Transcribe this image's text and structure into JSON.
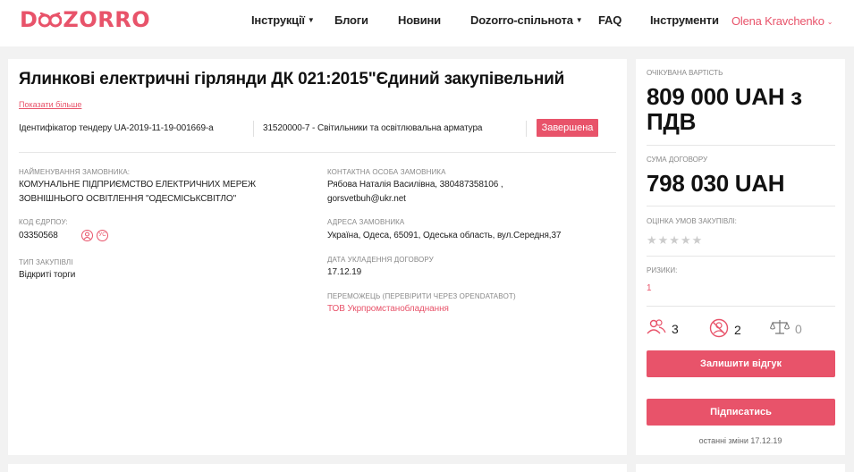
{
  "header": {
    "nav": [
      {
        "label": "Інструкції",
        "dropdown": true
      },
      {
        "label": "Блоги",
        "dropdown": false
      },
      {
        "label": "Новини",
        "dropdown": false
      },
      {
        "label": "Dozorro-спільнота",
        "dropdown": true
      },
      {
        "label": "FAQ",
        "dropdown": false
      },
      {
        "label": "Інструменти",
        "dropdown": false
      }
    ],
    "user": "Olena Kravchenko"
  },
  "tender": {
    "title": "Ялинкові електричні гірлянди ДК 021:2015\"Єдиний закупівельний",
    "show_more": "Показати більше",
    "id_text": "Ідентифікатор тендеру UA-2019-11-19-001669-a",
    "cpv": "31520000-7 - Світильники та освітлювальна арматура",
    "status": "Завершена"
  },
  "details": {
    "customer_label": "Найменування замовника:",
    "customer_line1": "КОМУНАЛЬНЕ ПІДПРИЄМСТВО ЕЛЕКТРИЧНИХ МЕРЕЖ",
    "customer_line2": "ЗОВНІШНЬОГО ОСВІТЛЕННЯ \"ОДЕСМІСЬКСВІТЛО\"",
    "edrpou_label": "Код ЄДРПОУ:",
    "edrpou": "03350568",
    "edrpou_icon2": "УС",
    "type_label": "Тип закупівлі",
    "type": "Відкриті торги",
    "contact_label": "Контактна особа замовника",
    "contact_line1": "Рябова Наталія Василівна, 380487358106 ,",
    "contact_line2": "gorsvetbuh@ukr.net",
    "address_label": "Адреса замовника",
    "address": "Україна, Одеса, 65091, Одеська область, вул.Середня,37",
    "contract_date_label": "Дата укладення договору",
    "contract_date": "17.12.19",
    "winner_label": "Переможець (перевірити через opendatabot)",
    "winner": "ТОВ Укрпромстанобладнання"
  },
  "side": {
    "expected_label": "Очікувана вартість",
    "expected_line1": "809 000 UAH з",
    "expected_line2": "ПДВ",
    "contract_label": "Сума договору",
    "contract_value": "798 030 UAH",
    "rating_label": "Оцінка умов закупівлі:",
    "stars": "★★★★★",
    "rating": 0,
    "risks_label": "Ризики:",
    "risks": "1",
    "stats": [
      {
        "icon": "users-icon",
        "value": "3"
      },
      {
        "icon": "no-user-icon",
        "value": "2"
      },
      {
        "icon": "scales-icon",
        "value": "0"
      }
    ],
    "review_button": "Залишити відгук",
    "subscribe_button": "Підписатись",
    "last_changed": "останні зміни 17.12.19"
  },
  "colors": {
    "accent": "#e8536a",
    "background": "#f2f2f2"
  }
}
